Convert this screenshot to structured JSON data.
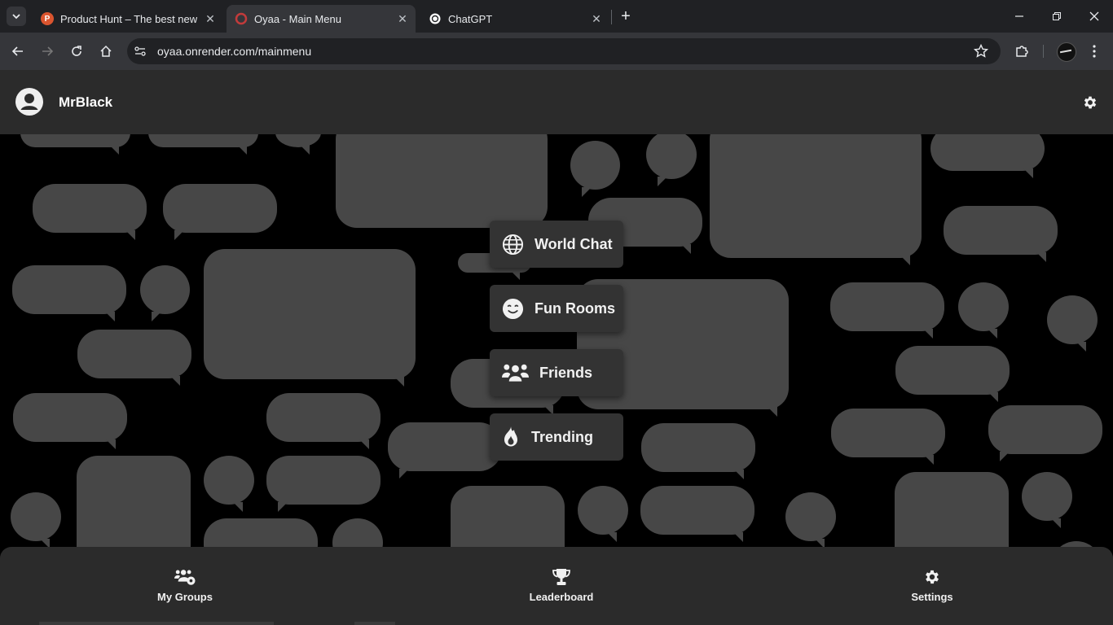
{
  "browser": {
    "tabs": [
      {
        "title": "Product Hunt – The best new products in tech",
        "favicon_color": "#da552f",
        "favicon_letter": "P"
      },
      {
        "title": "Oyaa - Main Menu",
        "favicon_color": "#c23b3b"
      },
      {
        "title": "ChatGPT",
        "favicon_color": "#ffffff"
      }
    ],
    "url": "oyaa.onrender.com/mainmenu"
  },
  "header": {
    "username": "MrBlack"
  },
  "menu": {
    "items": [
      {
        "label": "World Chat",
        "icon": "globe-icon"
      },
      {
        "label": "Fun Rooms",
        "icon": "smile-icon"
      },
      {
        "label": "Friends",
        "icon": "users-icon"
      },
      {
        "label": "Trending",
        "icon": "fire-icon"
      }
    ]
  },
  "bottom_nav": {
    "items": [
      {
        "label": "My Groups",
        "icon": "group-gear-icon"
      },
      {
        "label": "Leaderboard",
        "icon": "trophy-icon"
      },
      {
        "label": "Settings",
        "icon": "gear-icon"
      }
    ]
  },
  "colors": {
    "header_bg": "#2b2b2b",
    "bubble": "#474747",
    "button_bg": "#333333",
    "page_bg": "#000000"
  }
}
